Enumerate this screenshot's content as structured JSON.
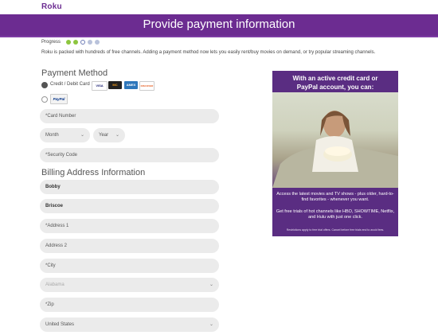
{
  "header": {
    "logo": "Roku",
    "banner_title": "Provide payment information"
  },
  "progress": {
    "label": "Progress",
    "steps": [
      "complete",
      "complete",
      "current",
      "pending",
      "pending"
    ],
    "colors": {
      "complete": "#8dc63f",
      "current": "#6c7bb5",
      "pending": "#b9c2db"
    }
  },
  "intro": "Roku is packed with hundreds of free channels. Adding a payment method now lets you easily rent/buy movies on demand, or try popular streaming channels.",
  "payment": {
    "heading": "Payment Method",
    "credit_label": "Credit / Debit Card",
    "cards": [
      "VISA",
      "MC",
      "AMEX",
      "DISCOVER"
    ],
    "paypal_label": "PayPal",
    "card_number_placeholder": "*Card Number",
    "month_label": "Month",
    "year_label": "Year",
    "security_placeholder": "*Security Code"
  },
  "billing": {
    "heading": "Billing Address Information",
    "first_name": "Bobby",
    "last_name": "Briscoe",
    "address1_placeholder": "*Address 1",
    "address2_placeholder": "Address 2",
    "city_placeholder": "*City",
    "state_value": "Alabama",
    "zip_placeholder": "*Zip",
    "country_value": "United States"
  },
  "promo": {
    "heading_line1": "With an active credit card or",
    "heading_line2": "PayPal account, you can:",
    "text1": "Access the latest movies and TV shows - plus older, hard-to-find favorites - whenever you want.",
    "text2": "Get free trials of hot channels like HBO, SHOWTIME, Netflix, and Hulu with just one click.",
    "fine_print": "Restrictions apply to free trial offers. Cancel before free trials end to avoid fees."
  }
}
